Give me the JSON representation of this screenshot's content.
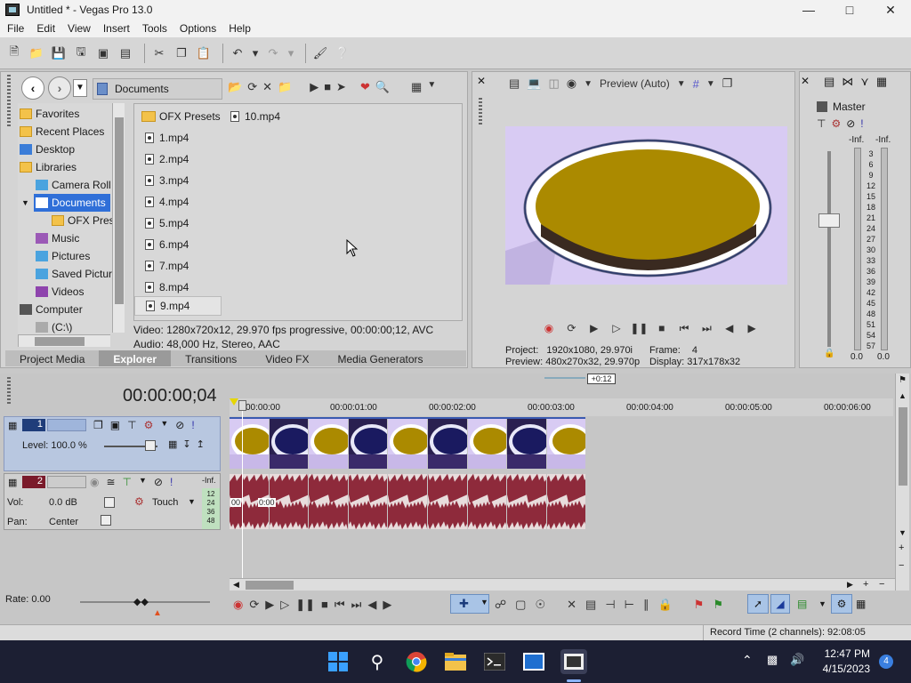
{
  "window": {
    "title": "Untitled * - Vegas Pro 13.0"
  },
  "menu": [
    "File",
    "Edit",
    "View",
    "Insert",
    "Tools",
    "Options",
    "Help"
  ],
  "explorer": {
    "path": "Documents",
    "tree": [
      {
        "label": "Favorites",
        "icon": "star-icon"
      },
      {
        "label": "Recent Places",
        "icon": "folder-icon"
      },
      {
        "label": "Desktop",
        "icon": "desktop-icon"
      },
      {
        "label": "Libraries",
        "icon": "folder-icon"
      },
      {
        "label": "Camera Roll",
        "icon": "image-icon"
      },
      {
        "label": "Documents",
        "icon": "document-icon",
        "selected": true
      },
      {
        "label": "OFX Pres",
        "icon": "folder-icon"
      },
      {
        "label": "Music",
        "icon": "music-icon"
      },
      {
        "label": "Pictures",
        "icon": "image-icon"
      },
      {
        "label": "Saved Pictur",
        "icon": "image-icon"
      },
      {
        "label": "Videos",
        "icon": "video-icon"
      },
      {
        "label": "Computer",
        "icon": "computer-icon"
      },
      {
        "label": "(C:\\)",
        "icon": "drive-icon"
      }
    ],
    "files_col1": [
      "OFX Presets",
      "1.mp4",
      "2.mp4",
      "3.mp4",
      "4.mp4",
      "5.mp4",
      "6.mp4",
      "7.mp4",
      "8.mp4",
      "9.mp4"
    ],
    "files_col2": [
      "10.mp4"
    ],
    "info_video": "Video: 1280x720x12, 29.970 fps progressive, 00:00:00;12, AVC",
    "info_audio": "Audio: 48,000 Hz, Stereo, AAC",
    "tabs": [
      "Project Media",
      "Explorer",
      "Transitions",
      "Video FX",
      "Media Generators"
    ]
  },
  "preview": {
    "mode": "Preview (Auto)",
    "project_label": "Project:",
    "project_value": "1920x1080, 29.970i",
    "preview_label": "Preview:",
    "preview_value": "480x270x32, 29.970p",
    "frame_label": "Frame:",
    "frame_value": "4",
    "display_label": "Display:",
    "display_value": "317x178x32"
  },
  "master": {
    "title": "Master",
    "inf_left": "-Inf.",
    "inf_right": "-Inf.",
    "scale": [
      "3",
      "6",
      "9",
      "12",
      "15",
      "18",
      "21",
      "24",
      "27",
      "30",
      "33",
      "36",
      "39",
      "42",
      "45",
      "48",
      "51",
      "54",
      "57"
    ],
    "bottom_left": "0.0",
    "bottom_right": "0.0"
  },
  "timeline": {
    "timecode": "00:00:00;04",
    "offset_badge": "+0:12",
    "ruler": [
      "00:00:00",
      "00:00:01:00",
      "00:00:02:00",
      "00:00:03:00",
      "00:00:04:00",
      "00:00:05:00",
      "00:00:06:00"
    ],
    "track1": {
      "number": "1",
      "level_label": "Level: 100.0 %"
    },
    "track2": {
      "number": "2",
      "vol_label": "Vol:",
      "vol_value": "0.0 dB",
      "pan_label": "Pan:",
      "pan_value": "Center",
      "automation": "Touch",
      "inf": "-Inf.",
      "meter_scale": [
        "12",
        "24",
        "36",
        "48"
      ]
    },
    "audio_marker_a": "00",
    "audio_marker_b": "0:00",
    "rate": "Rate: 0.00"
  },
  "status": {
    "record_time": "Record Time (2 channels): 92:08:05"
  },
  "taskbar": {
    "time": "12:47 PM",
    "date": "4/15/2023",
    "notifications": "4"
  },
  "colors": {
    "selection": "#2f6fd8",
    "video_clip": "#6b5a00",
    "audio_clip": "#8e2a3b",
    "taskbar": "#1c1f33"
  }
}
